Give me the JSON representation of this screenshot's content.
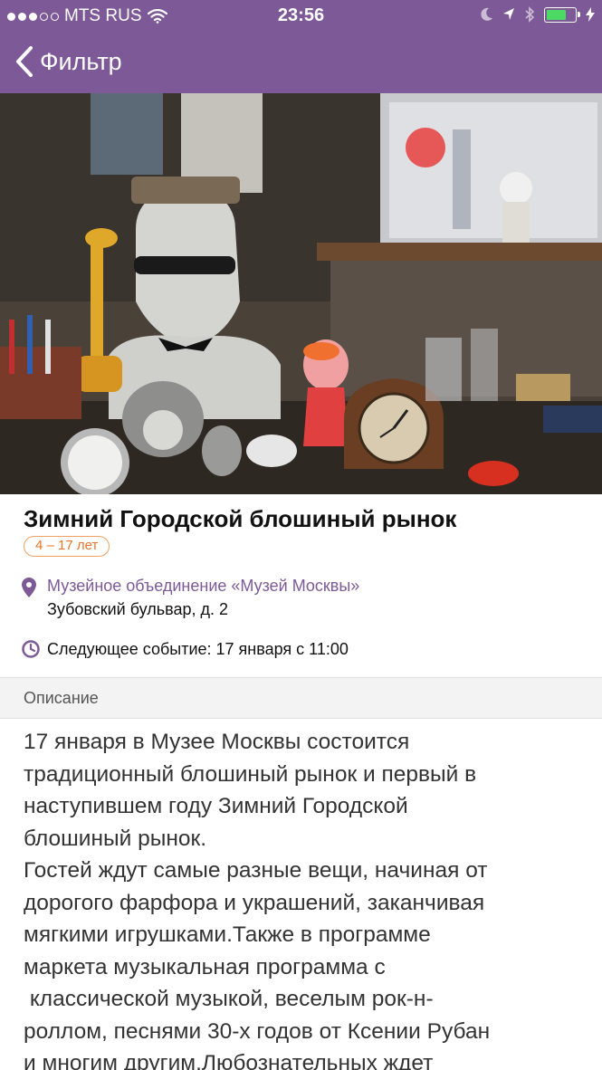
{
  "status_bar": {
    "carrier": "MTS RUS",
    "time": "23:56",
    "signal_bars_filled": 3,
    "signal_bars_total": 5,
    "battery_level": 0.7
  },
  "nav": {
    "back_label": "Фильтр",
    "icon": "chevron-left-icon"
  },
  "event": {
    "title": "Зимний Городской блошиный рынок",
    "age": "4 – 17 лет",
    "venue": "Музейное объединение «Музей Москвы»",
    "address": "Зубовский бульвар, д. 2",
    "next_event": "Следующее событие: 17 января с 11:00"
  },
  "description": {
    "header": "Описание",
    "text": "17 января в Музее Москвы состоится\nтрадиционный блошиный рынок и первый в\nнаступившем году Зимний Городской\nблошиный рынок.\nГостей ждут самые разные вещи, начиная от\nдорогого фарфора и украшений, заканчивая\nмягкими игрушками.Также в программе\nмаркета музыкальная программа с\n классической музыкой, веселым рок-н-\nроллом, песнями 30-х годов от Ксении Рубан\nи многим другим.Любознательных ждет"
  },
  "colors": {
    "brand": "#7d5a97",
    "badge": "#e8762c",
    "battery": "#4cd964"
  }
}
